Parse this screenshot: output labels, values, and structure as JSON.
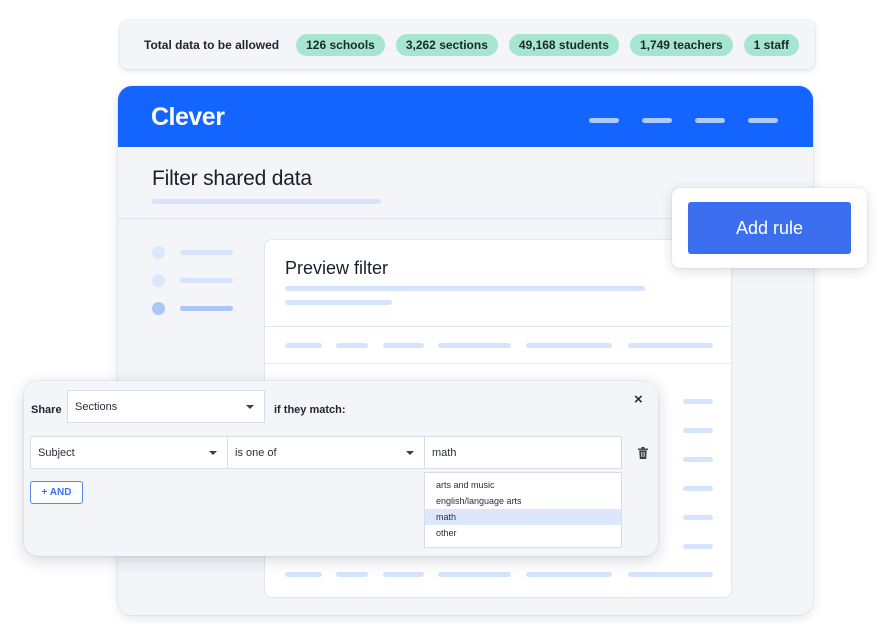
{
  "stats": {
    "label": "Total data to be allowed",
    "pills": [
      "126 schools",
      "3,262 sections",
      "49,168 students",
      "1,749 teachers",
      "1 staff"
    ]
  },
  "app": {
    "brand": "Clever",
    "page_title": "Filter shared data",
    "preview_title": "Preview filter",
    "accent_color": "#1464ff"
  },
  "add_rule": {
    "label": "Add rule"
  },
  "filter": {
    "share_label": "Share",
    "share_value": "Sections",
    "match_label": "if they match:",
    "field_value": "Subject",
    "operator_value": "is one of",
    "input_value": "math",
    "and_label": "+ AND",
    "options": [
      "arts and music",
      "english/language arts",
      "math",
      "other"
    ],
    "selected_option": "math"
  },
  "icons": {
    "close": "close-icon",
    "trash": "trash-icon",
    "dropdown": "chevron-down-icon"
  }
}
